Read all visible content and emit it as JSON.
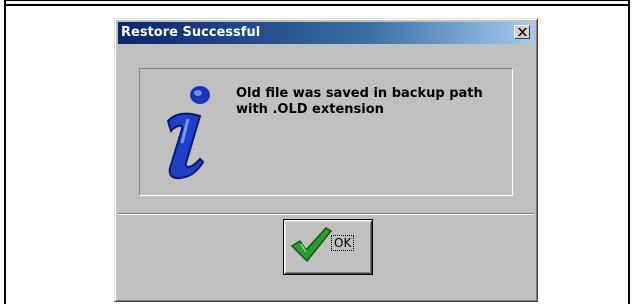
{
  "dialog": {
    "title": "Restore Successful",
    "message": "Old file was saved in backup path with .OLD extension",
    "close_icon": "close-x-icon",
    "info_icon": "information-i-icon",
    "ok_button": {
      "label": "OK",
      "icon": "green-checkmark-icon"
    }
  },
  "colors": {
    "titlebar_start": "#0a246a",
    "titlebar_end": "#a6caf0",
    "dialog_face": "#c0c0c0",
    "info_icon": "#1f3fc8",
    "check_icon": "#2e9b2e"
  }
}
